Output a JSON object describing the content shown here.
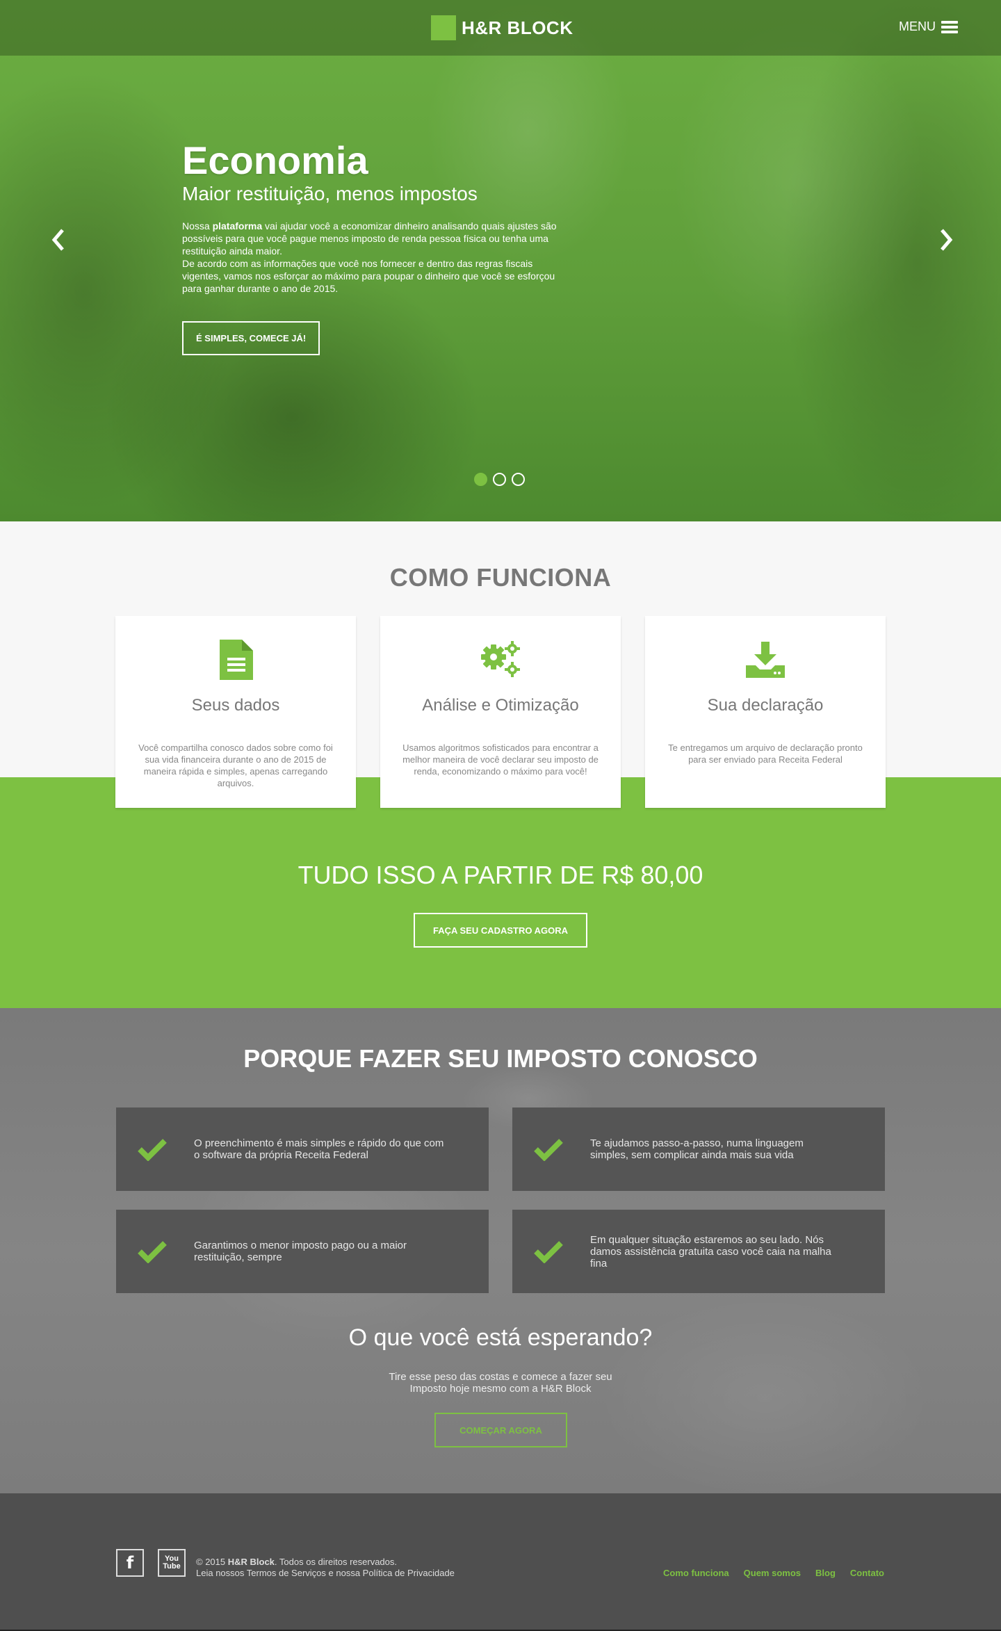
{
  "brand": {
    "name": "H&R BLOCK",
    "accent": "#7dc142"
  },
  "nav": {
    "menu_label": "MENU",
    "menu_icon": "hamburger-icon"
  },
  "hero": {
    "title": "Economia",
    "subtitle": "Maior restituição, menos impostos",
    "text_pre": "Nossa ",
    "text_bold": "plataforma",
    "text_post": " vai ajudar você a economizar dinheiro analisando quais ajustes são possíveis para que você pague menos imposto de renda pessoa física ou tenha uma restituição ainda maior.",
    "text_2": "De acordo com as informações que você nos fornecer e dentro das regras fiscais vigentes, vamos nos esforçar ao máximo para poupar o dinheiro que você se esforçou para ganhar durante o ano de 2015.",
    "cta": "É SIMPLES, COMECE JÁ!",
    "slides_count": 3,
    "active_slide": 1
  },
  "como_funciona": {
    "title": "COMO FUNCIONA",
    "cards": [
      {
        "icon": "document-icon",
        "title": "Seus dados",
        "text": "Você compartilha conosco dados sobre como foi sua vida financeira durante o ano de 2015 de maneira rápida e simples, apenas carregando arquivos."
      },
      {
        "icon": "gears-icon",
        "title": "Análise e Otimização",
        "text": "Usamos algoritmos sofisticados para encontrar a melhor maneira de você declarar seu imposto de renda, economizando o máximo para você!"
      },
      {
        "icon": "download-icon",
        "title": "Sua declaração",
        "text": "Te entregamos um arquivo de declaração pronto para ser enviado para Receita Federal"
      }
    ],
    "price_text": "TUDO ISSO A PARTIR DE R$ 80,00",
    "cta": "FAÇA SEU CADASTRO AGORA"
  },
  "porque": {
    "title": "PORQUE FAZER SEU IMPOSTO CONOSCO",
    "benefits": [
      "O preenchimento é mais simples e rápido do que com o software da própria Receita Federal",
      "Te ajudamos passo-a-passo, numa linguagem simples, sem complicar ainda mais sua vida",
      "Garantimos o menor imposto pago ou a maior restituição, sempre",
      "Em qualquer situação estaremos ao seu lado. Nós damos assistência gratuita caso você caia na malha fina"
    ],
    "esperando_title": "O que você está esperando?",
    "esperando_text": "Tire esse peso das costas e comece a fazer seu Imposto hoje mesmo com a H&R Block",
    "cta": "COMEÇAR AGORA"
  },
  "footer": {
    "facebook_glyph": "f",
    "youtube_glyph_top": "You",
    "youtube_glyph_bottom": "Tube",
    "copyright_prefix": "© 2015 ",
    "copyright_brand": "H&R Block",
    "copyright_suffix": ". Todos os direitos reservados.",
    "legal_line": "Leia nossos Termos de Serviços e nossa Política de Privacidade",
    "links": [
      "Como funciona",
      "Quem somos",
      "Blog",
      "Contato"
    ]
  }
}
